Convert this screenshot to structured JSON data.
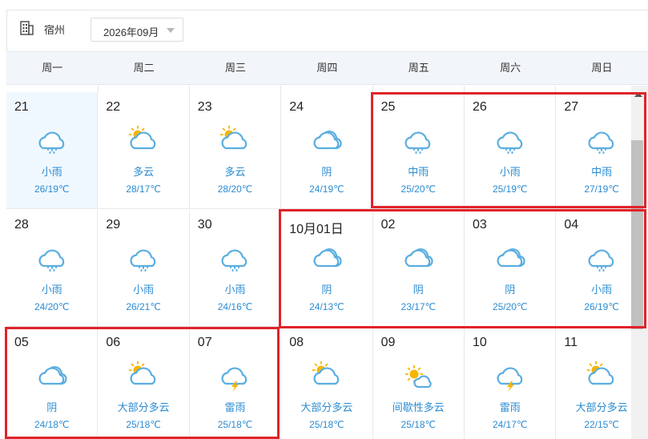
{
  "header": {
    "city_icon": "building-icon",
    "city": "宿州",
    "month": "2026年09月"
  },
  "weekdays": [
    "周一",
    "周二",
    "周三",
    "周四",
    "周五",
    "周六",
    "周日"
  ],
  "colors": {
    "text_blue": "#2a8bd1",
    "highlight_red": "#e0232a",
    "cloud_blue": "#5aaee0",
    "sun_yellow": "#f7b500"
  },
  "days": [
    {
      "day": "21",
      "icon": "rain-icon",
      "cond": "小雨",
      "temp": "26/19℃",
      "today": true
    },
    {
      "day": "22",
      "icon": "partly-cloudy-icon",
      "cond": "多云",
      "temp": "28/17℃"
    },
    {
      "day": "23",
      "icon": "partly-cloudy-icon",
      "cond": "多云",
      "temp": "28/20℃"
    },
    {
      "day": "24",
      "icon": "overcast-icon",
      "cond": "阴",
      "temp": "24/19℃"
    },
    {
      "day": "25",
      "icon": "rain-icon",
      "cond": "中雨",
      "temp": "25/20℃"
    },
    {
      "day": "26",
      "icon": "rain-icon",
      "cond": "小雨",
      "temp": "25/19℃"
    },
    {
      "day": "27",
      "icon": "rain-icon",
      "cond": "中雨",
      "temp": "27/19℃"
    },
    {
      "day": "28",
      "icon": "rain-icon",
      "cond": "小雨",
      "temp": "24/20℃"
    },
    {
      "day": "29",
      "icon": "rain-icon",
      "cond": "小雨",
      "temp": "26/21℃"
    },
    {
      "day": "30",
      "icon": "rain-icon",
      "cond": "小雨",
      "temp": "24/16℃"
    },
    {
      "day": "10月01日",
      "icon": "overcast-icon",
      "cond": "阴",
      "temp": "24/13℃"
    },
    {
      "day": "02",
      "icon": "overcast-icon",
      "cond": "阴",
      "temp": "23/17℃"
    },
    {
      "day": "03",
      "icon": "overcast-icon",
      "cond": "阴",
      "temp": "25/20℃"
    },
    {
      "day": "04",
      "icon": "rain-icon",
      "cond": "小雨",
      "temp": "26/19℃"
    },
    {
      "day": "05",
      "icon": "overcast-icon",
      "cond": "阴",
      "temp": "24/18℃"
    },
    {
      "day": "06",
      "icon": "partly-cloudy-icon",
      "cond": "大部分多云",
      "temp": "25/18℃"
    },
    {
      "day": "07",
      "icon": "thunderstorm-icon",
      "cond": "雷雨",
      "temp": "25/18℃"
    },
    {
      "day": "08",
      "icon": "partly-cloudy-icon",
      "cond": "大部分多云",
      "temp": "25/18℃"
    },
    {
      "day": "09",
      "icon": "intermittent-cloudy-icon",
      "cond": "间歇性多云",
      "temp": "25/18℃"
    },
    {
      "day": "10",
      "icon": "thunderstorm-icon",
      "cond": "雷雨",
      "temp": "24/17℃"
    },
    {
      "day": "11",
      "icon": "partly-cloudy-icon",
      "cond": "大部分多云",
      "temp": "22/15℃"
    }
  ]
}
